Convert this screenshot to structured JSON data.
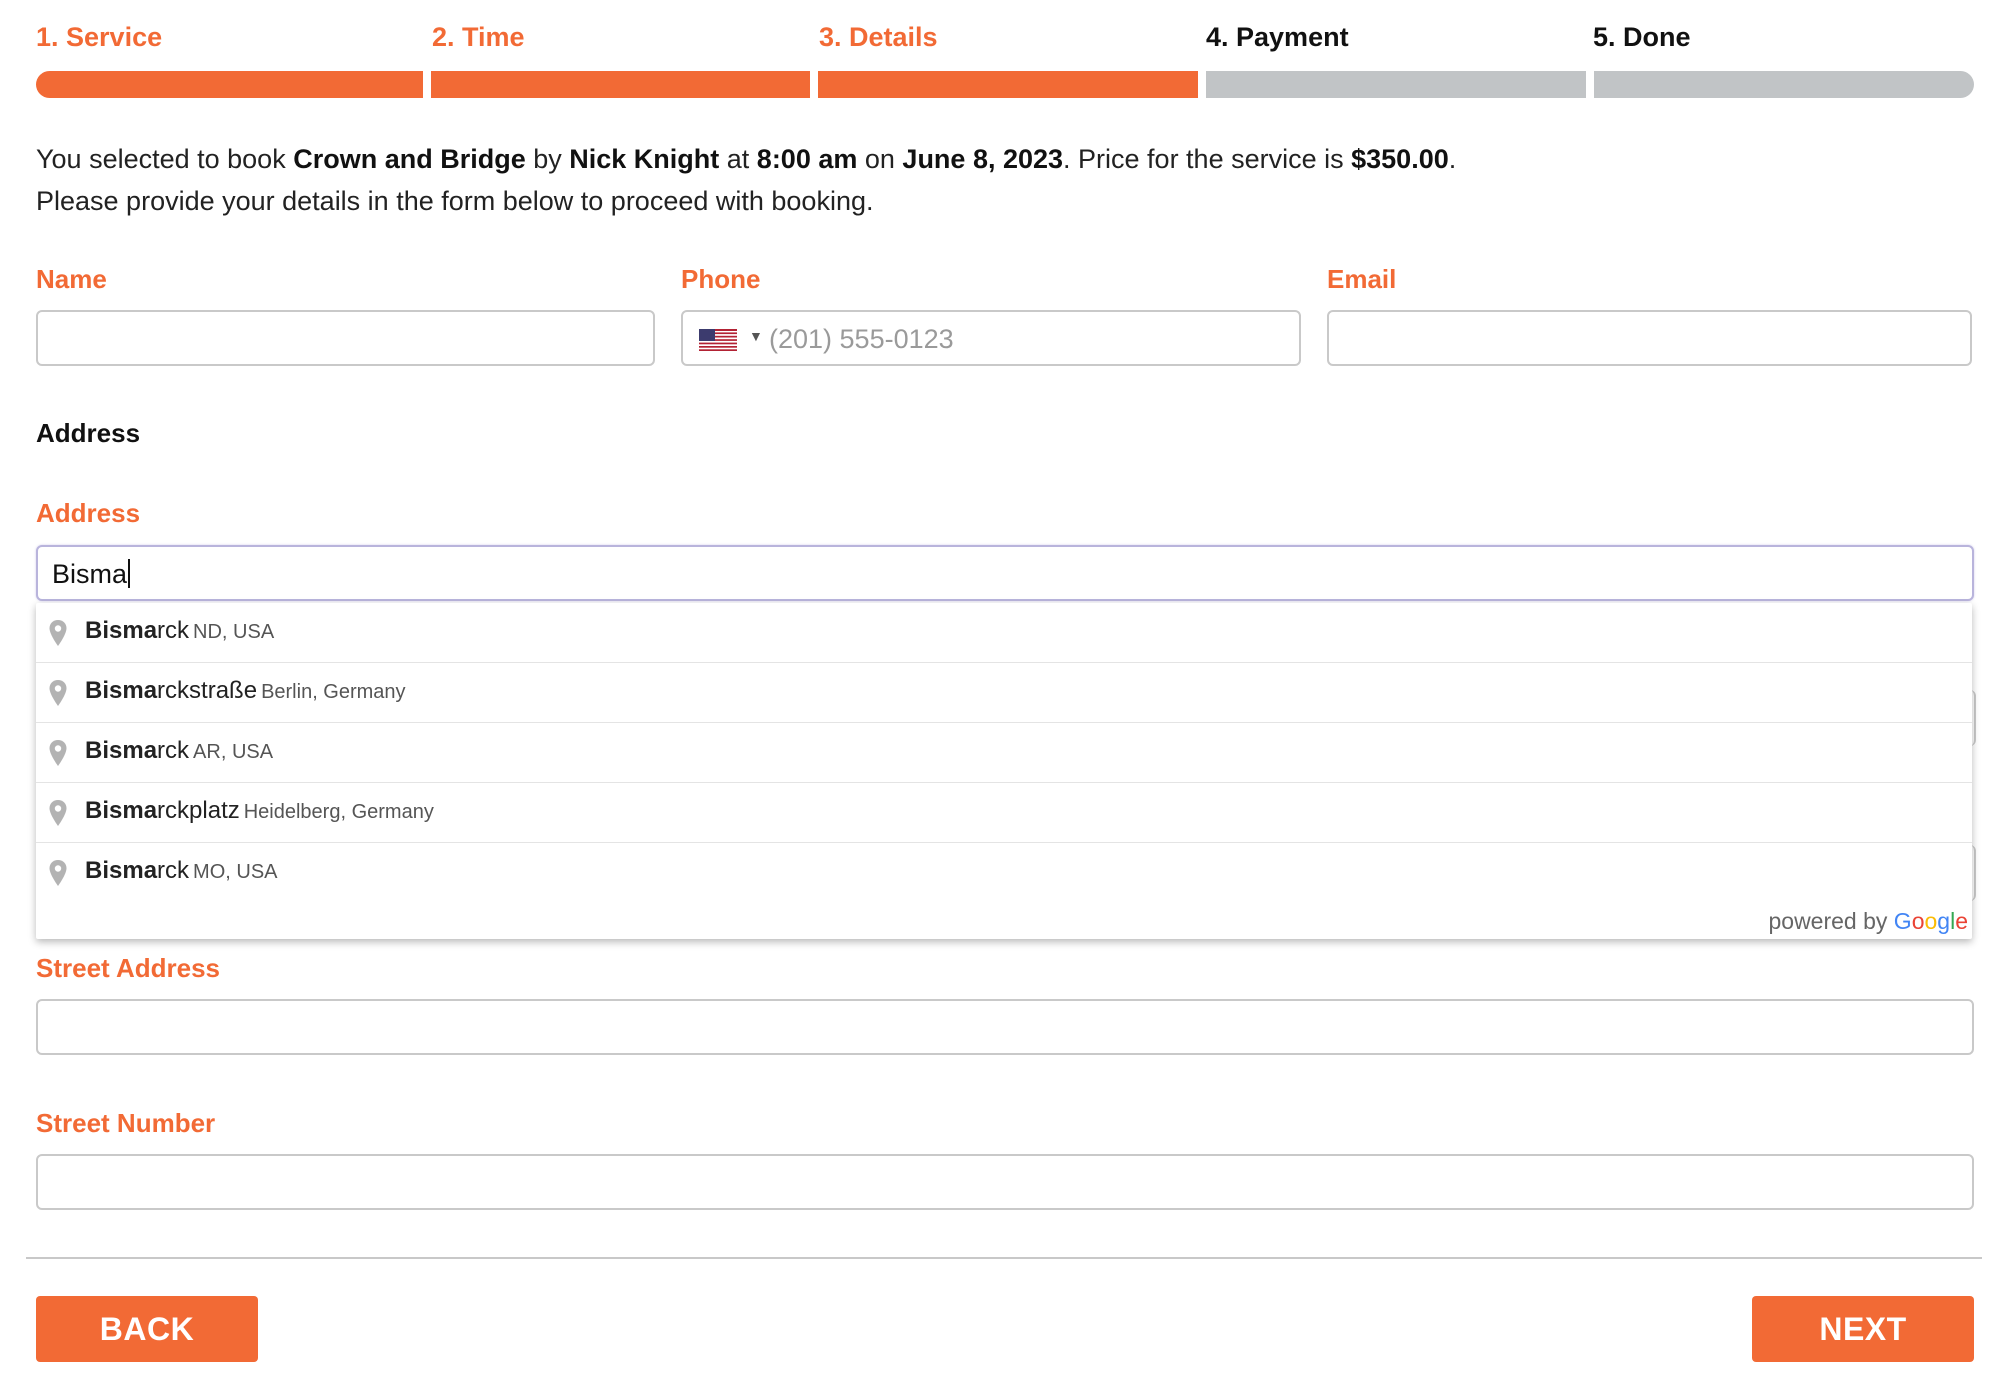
{
  "steps": [
    {
      "label": "1. Service",
      "state": "active"
    },
    {
      "label": "2. Time",
      "state": "active"
    },
    {
      "label": "3. Details",
      "state": "active"
    },
    {
      "label": "4. Payment",
      "state": "inactive"
    },
    {
      "label": "5. Done",
      "state": "inactive"
    }
  ],
  "colors": {
    "accent": "#f26a35",
    "inactive_bar": "#c1c4c6"
  },
  "info": {
    "t1": "You selected to book ",
    "service": "Crown and Bridge",
    "t2": " by ",
    "staff": "Nick Knight",
    "t3": " at ",
    "time": "8:00 am",
    "t4": " on ",
    "date": "June 8, 2023",
    "t5": ". Price for the service is ",
    "price": "$350.00",
    "t6": ".",
    "line2": "Please provide your details in the form below to proceed with booking."
  },
  "form": {
    "name_label": "Name",
    "phone_label": "Phone",
    "phone_placeholder": "(201) 555-0123",
    "phone_country_icon": "us-flag-icon",
    "email_label": "Email",
    "address_heading": "Address",
    "address_label": "Address",
    "address_value": "Bisma",
    "street_address_label": "Street Address",
    "street_number_label": "Street Number"
  },
  "autocomplete": {
    "items": [
      {
        "match": "Bisma",
        "rest": "rck",
        "secondary": "ND, USA"
      },
      {
        "match": "Bisma",
        "rest": "rckstraße",
        "secondary": "Berlin, Germany"
      },
      {
        "match": "Bisma",
        "rest": "rck",
        "secondary": "AR, USA"
      },
      {
        "match": "Bisma",
        "rest": "rckplatz",
        "secondary": "Heidelberg, Germany"
      },
      {
        "match": "Bisma",
        "rest": "rck",
        "secondary": "MO, USA"
      }
    ],
    "powered_by": "powered by",
    "google": [
      "G",
      "o",
      "o",
      "g",
      "l",
      "e"
    ]
  },
  "buttons": {
    "back": "BACK",
    "next": "NEXT"
  }
}
